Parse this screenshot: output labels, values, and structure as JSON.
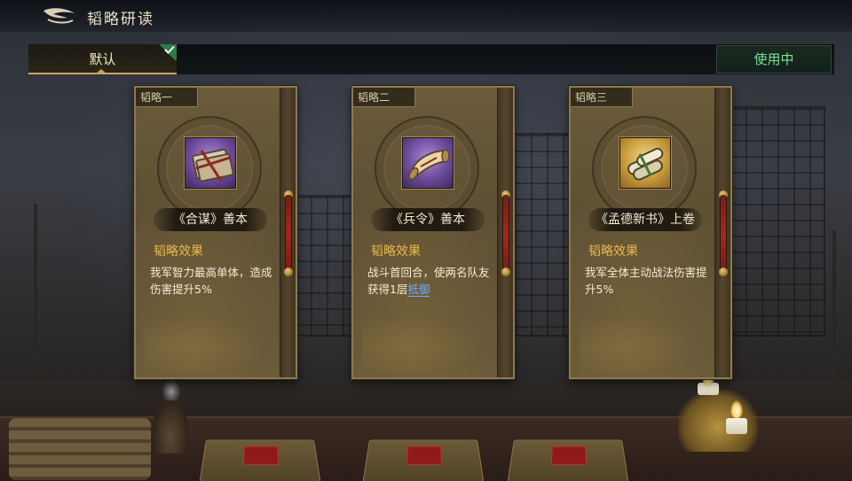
{
  "header": {
    "title": "韬略研读"
  },
  "tabs": {
    "default_label": "默认",
    "in_use_label": "使用中"
  },
  "cards": [
    {
      "tag": "韬略一",
      "name": "《合谋》善本",
      "effect_label": "韬略效果",
      "desc_text": "我军智力最高单体，造成伤害提升5%",
      "keyword": "",
      "icon": "book-bundle-icon",
      "icon_rarity": "purple"
    },
    {
      "tag": "韬略二",
      "name": "《兵令》善本",
      "effect_label": "韬略效果",
      "desc_text": "战斗首回合，使两名队友获得1层",
      "keyword": "抵御",
      "icon": "scroll-icon",
      "icon_rarity": "purple"
    },
    {
      "tag": "韬略三",
      "name": "《孟德新书》上卷",
      "effect_label": "韬略效果",
      "desc_text": "我军全体主动战法伤害提升5%",
      "keyword": "",
      "icon": "scroll-bundle-icon",
      "icon_rarity": "gold"
    }
  ],
  "colors": {
    "accent_gold": "#c7a65a",
    "in_use_green": "#7be09b",
    "effect_label": "#e8b84f",
    "keyword_blue": "#6fb0ff",
    "rarity_purple": "#6b4a9a",
    "rarity_gold": "#c79b3c"
  }
}
